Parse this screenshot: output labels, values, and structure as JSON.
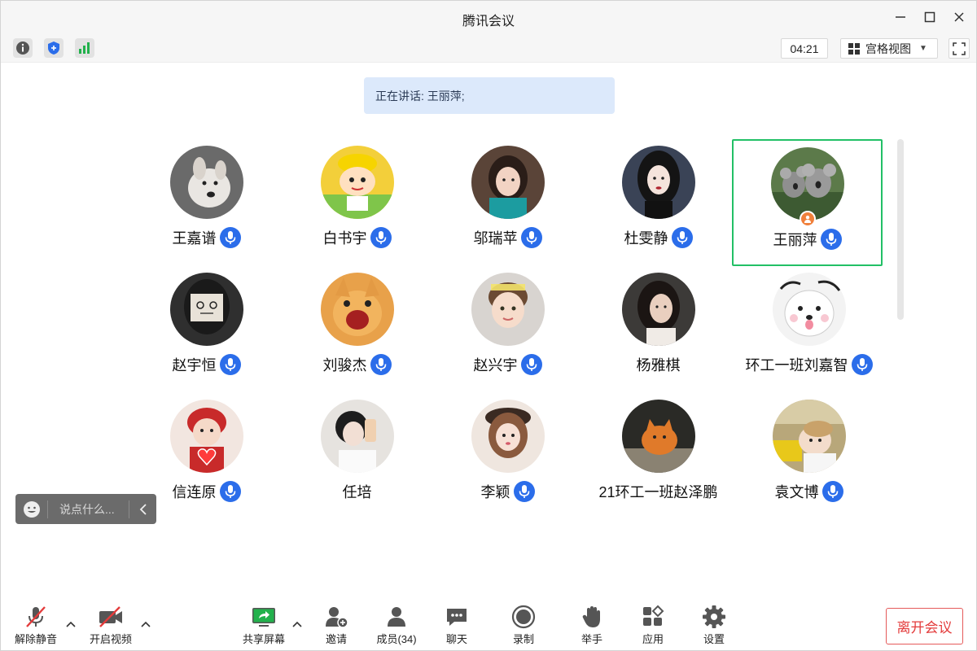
{
  "window": {
    "title": "腾讯会议"
  },
  "toolbar": {
    "timer": "04:21",
    "view_label": "宫格视图",
    "icons": [
      "info-icon",
      "shield-icon",
      "signal-icon"
    ]
  },
  "speaking": {
    "text": "正在讲话: 王丽萍;"
  },
  "participants": [
    {
      "name": "王嘉谱",
      "mic": true,
      "avatar": "dog-photo"
    },
    {
      "name": "白书宇",
      "mic": true,
      "avatar": "cartoon-boy"
    },
    {
      "name": "邬瑞苹",
      "mic": true,
      "avatar": "girl-photo"
    },
    {
      "name": "杜雯静",
      "mic": true,
      "avatar": "woman-portrait"
    },
    {
      "name": "王丽萍",
      "mic": true,
      "active": true,
      "host": true,
      "avatar": "koalas-photo"
    },
    {
      "name": "赵宇恒",
      "mic": true,
      "avatar": "masked-figure"
    },
    {
      "name": "刘骏杰",
      "mic": true,
      "avatar": "cat-meme"
    },
    {
      "name": "赵兴宇",
      "mic": true,
      "avatar": "child-photo"
    },
    {
      "name": "杨雅棋",
      "mic": false,
      "avatar": "woman-photo"
    },
    {
      "name": "环工一班刘嘉智",
      "mic": true,
      "avatar": "white-dog-drawing"
    },
    {
      "name": "信连原",
      "mic": true,
      "avatar": "kid-heart-photo"
    },
    {
      "name": "任培",
      "mic": false,
      "avatar": "selfie-photo"
    },
    {
      "name": "李颖",
      "mic": true,
      "avatar": "girl-beret-photo"
    },
    {
      "name": "21环工一班赵泽鹏",
      "mic": false,
      "avatar": "orange-cat-photo"
    },
    {
      "name": "袁文博",
      "mic": true,
      "avatar": "baby-photo"
    }
  ],
  "chat": {
    "placeholder": "说点什么..."
  },
  "bottombar": {
    "unmute": "解除静音",
    "start_video": "开启视频",
    "share_screen": "共享屏幕",
    "invite": "邀请",
    "members": "成员(34)",
    "chat": "聊天",
    "record": "录制",
    "raise_hand": "举手",
    "apps": "应用",
    "settings": "设置",
    "leave": "离开会议"
  },
  "colors": {
    "accent_blue": "#2b6dea",
    "active_green": "#22c066",
    "leave_red": "#e33b3b",
    "banner_bg": "#dce9fb",
    "host_orange": "#f0803b"
  }
}
